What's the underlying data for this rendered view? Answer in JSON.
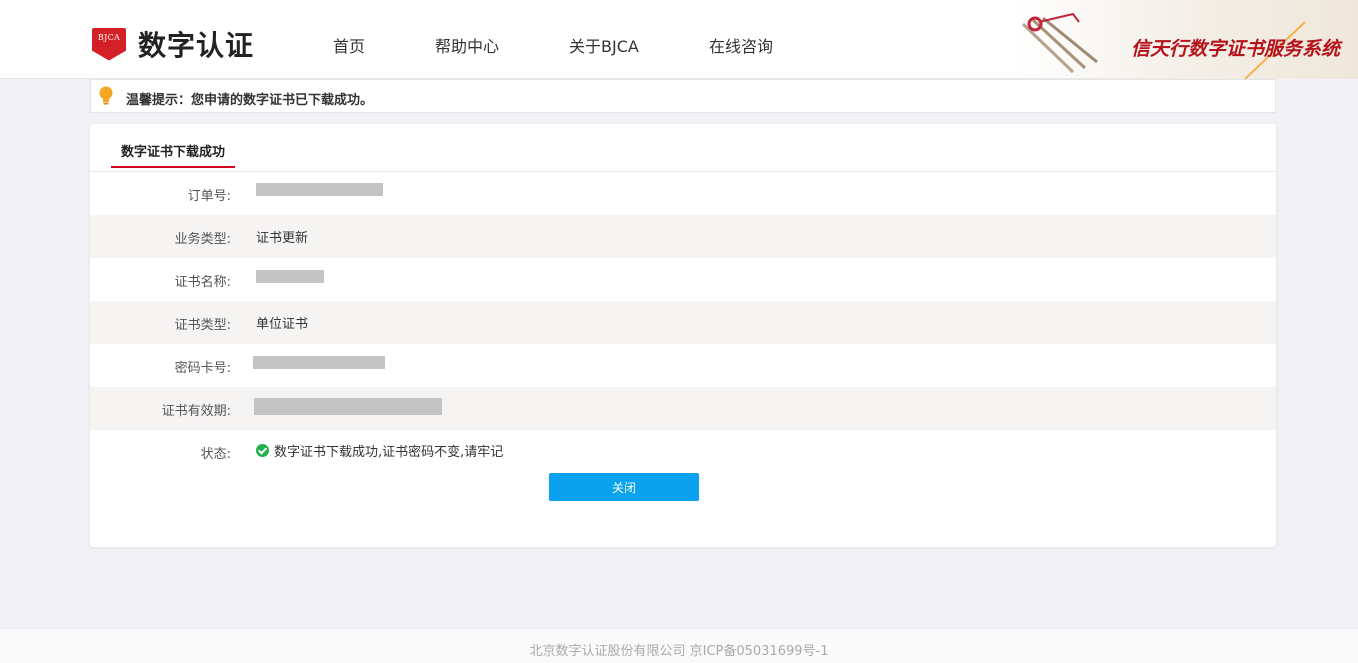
{
  "header": {
    "logo_badge": "BJCA",
    "logo_text": "数字认证",
    "nav": [
      "首页",
      "帮助中心",
      "关于BJCA",
      "在线咨询"
    ],
    "banner_text": "信天行数字证书服务系统"
  },
  "notice": {
    "text": "温馨提示：您申请的数字证书已下载成功。",
    "icon": "lightbulb-icon"
  },
  "card": {
    "tab": "数字证书下载成功",
    "rows": [
      {
        "label": "订单号:",
        "value": ""
      },
      {
        "label": "业务类型:",
        "value": "证书更新"
      },
      {
        "label": "证书名称:",
        "value": ""
      },
      {
        "label": "证书类型:",
        "value": "单位证书"
      },
      {
        "label": "密码卡号:",
        "value": ""
      },
      {
        "label": "证书有效期:",
        "value": ""
      },
      {
        "label": "状态:",
        "value": "数字证书下载成功,证书密码不变,请牢记"
      }
    ],
    "close_label": "关闭"
  },
  "footer": {
    "text": "北京数字认证股份有限公司 京ICP备05031699号-1"
  },
  "colors": {
    "accent": "#0aa1ef",
    "brand_red": "#d31f26",
    "tab_underline": "#d0021b",
    "success": "#21b14a"
  }
}
